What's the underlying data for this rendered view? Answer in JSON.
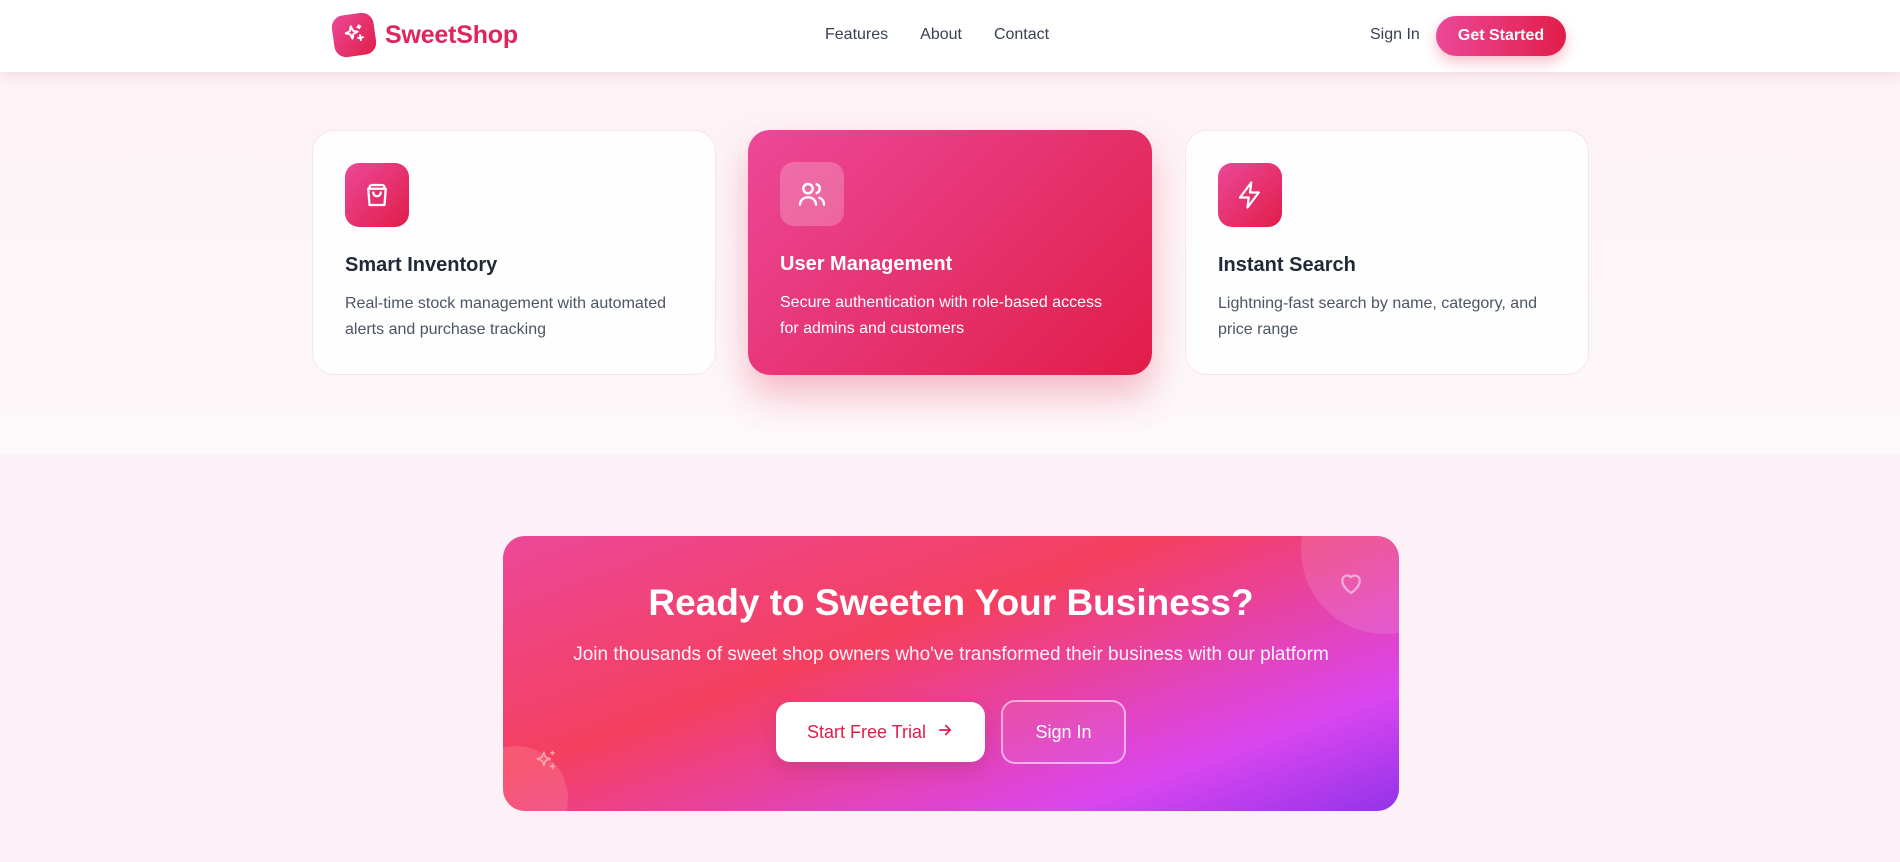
{
  "brand": {
    "name": "SweetShop",
    "icon": "sparkles-icon"
  },
  "nav": {
    "links": [
      "Features",
      "About",
      "Contact"
    ],
    "sign_in": "Sign In",
    "cta": "Get Started"
  },
  "features": [
    {
      "icon": "shopping-bag-icon",
      "title": "Smart Inventory",
      "description": "Real-time stock management with automated alerts and purchase tracking"
    },
    {
      "icon": "users-icon",
      "title": "User Management",
      "description": "Secure authentication with role-based access for admins and customers"
    },
    {
      "icon": "lightning-icon",
      "title": "Instant Search",
      "description": "Lightning-fast search by name, category, and price range"
    }
  ],
  "cta": {
    "title": "Ready to Sweeten Your Business?",
    "subtitle": "Join thousands of sweet shop owners who've transformed their business with our platform",
    "primary_button": "Start Free Trial",
    "secondary_button": "Sign In"
  },
  "colors": {
    "accent": "#e11d48",
    "accent_pink": "#ec4899",
    "gradient_end": "#9333ea"
  }
}
